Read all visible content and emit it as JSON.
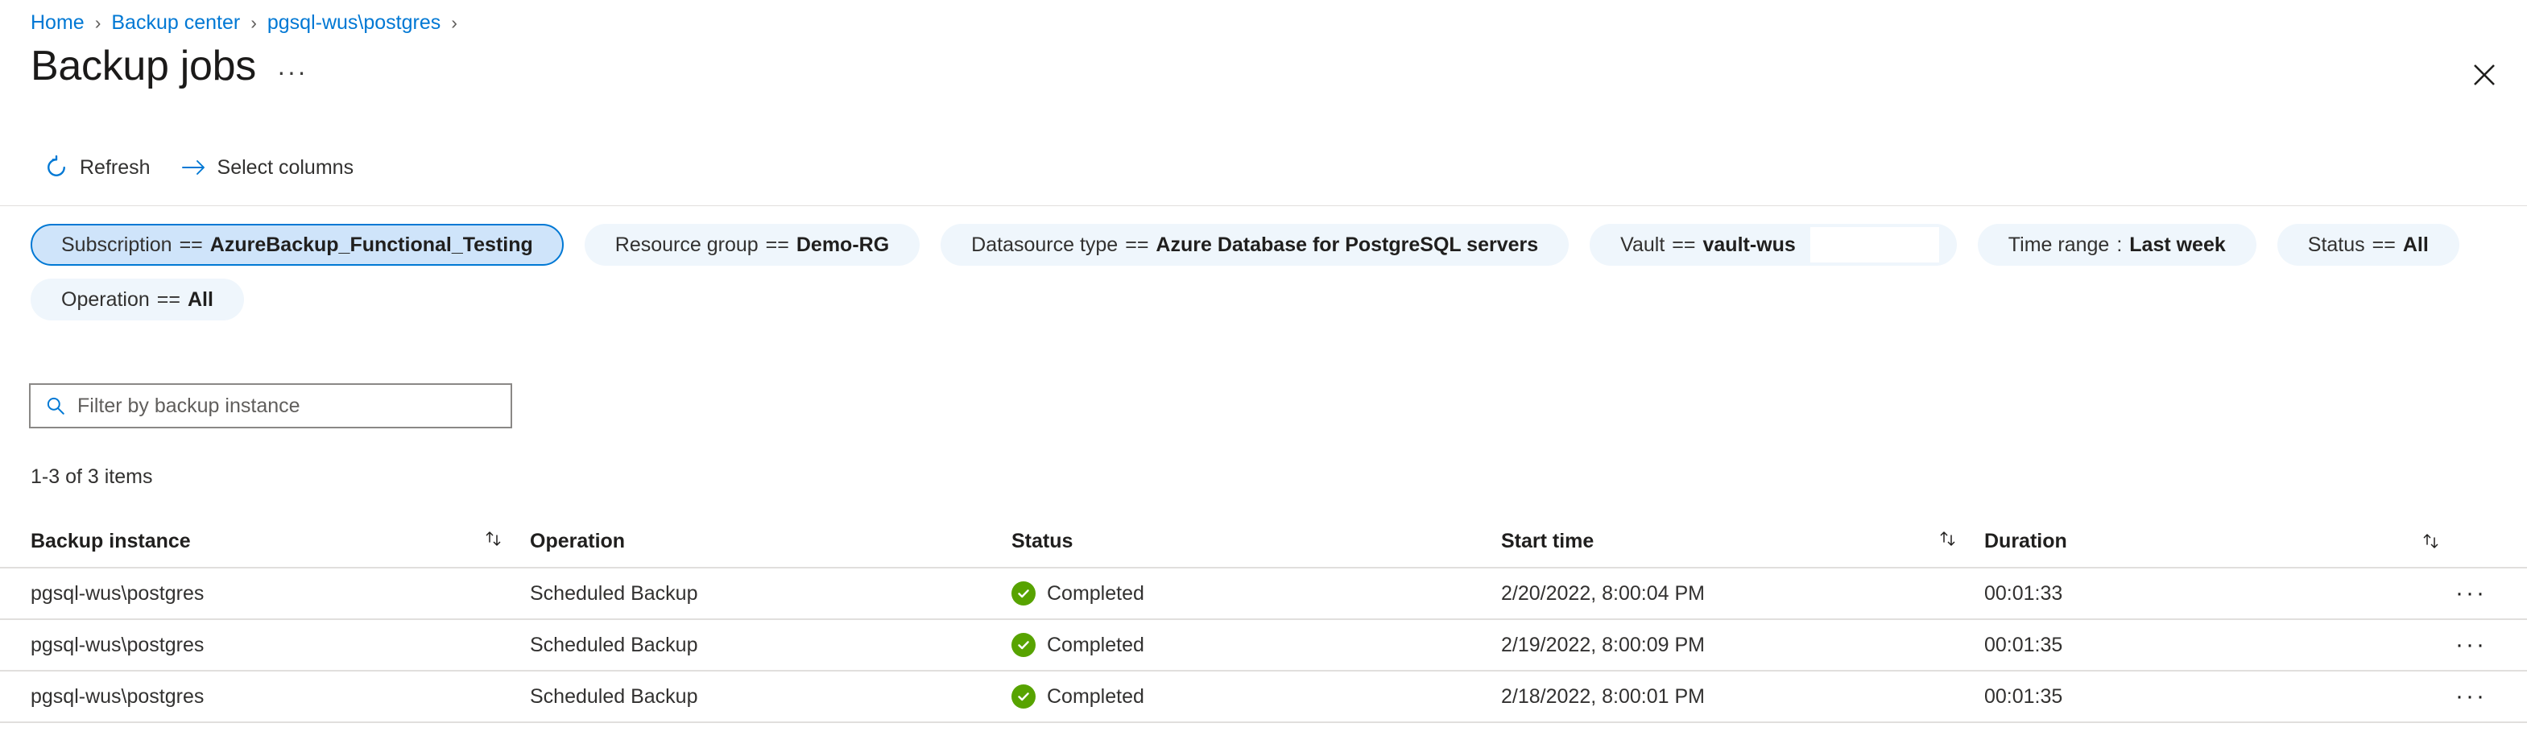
{
  "breadcrumb": {
    "items": [
      {
        "label": "Home"
      },
      {
        "label": "Backup center"
      },
      {
        "label": "pgsql-wus\\postgres"
      }
    ],
    "separator": "›"
  },
  "header": {
    "title": "Backup jobs",
    "more_label": "···",
    "close_icon": "close-icon"
  },
  "toolbar": {
    "refresh_label": "Refresh",
    "refresh_icon": "refresh-icon",
    "select_columns_label": "Select columns",
    "select_columns_icon": "arrow-right-icon"
  },
  "filters": [
    {
      "key": "Subscription",
      "op": "==",
      "value": "AzureBackup_Functional_Testing",
      "selected": true,
      "redacted": false
    },
    {
      "key": "Resource group",
      "op": "==",
      "value": "Demo-RG",
      "selected": false,
      "redacted": false
    },
    {
      "key": "Datasource type",
      "op": "==",
      "value": "Azure Database for PostgreSQL servers",
      "selected": false,
      "redacted": false
    },
    {
      "key": "Vault",
      "op": "==",
      "value": "vault-wus",
      "selected": false,
      "redacted": true
    },
    {
      "key": "Time range",
      "op": ":",
      "value": "Last week",
      "selected": false,
      "redacted": false
    },
    {
      "key": "Status",
      "op": "==",
      "value": "All",
      "selected": false,
      "redacted": false
    },
    {
      "key": "Operation",
      "op": "==",
      "value": "All",
      "selected": false,
      "redacted": false
    }
  ],
  "search": {
    "placeholder": "Filter by backup instance",
    "value": "",
    "icon": "search-icon"
  },
  "results": {
    "count_label": "1-3 of 3 items"
  },
  "table": {
    "columns": {
      "instance": "Backup instance",
      "operation": "Operation",
      "status": "Status",
      "start_time": "Start time",
      "duration": "Duration"
    },
    "rows": [
      {
        "instance": "pgsql-wus\\postgres",
        "operation": "Scheduled Backup",
        "status": "Completed",
        "start_time": "2/20/2022, 8:00:04 PM",
        "duration": "00:01:33",
        "menu": "···"
      },
      {
        "instance": "pgsql-wus\\postgres",
        "operation": "Scheduled Backup",
        "status": "Completed",
        "start_time": "2/19/2022, 8:00:09 PM",
        "duration": "00:01:35",
        "menu": "···"
      },
      {
        "instance": "pgsql-wus\\postgres",
        "operation": "Scheduled Backup",
        "status": "Completed",
        "start_time": "2/18/2022, 8:00:01 PM",
        "duration": "00:01:35",
        "menu": "···"
      }
    ]
  },
  "colors": {
    "link": "#0078d4",
    "pill_bg": "#eff6fc",
    "pill_selected_bg": "#cfe4fa",
    "status_success": "#57a300"
  }
}
